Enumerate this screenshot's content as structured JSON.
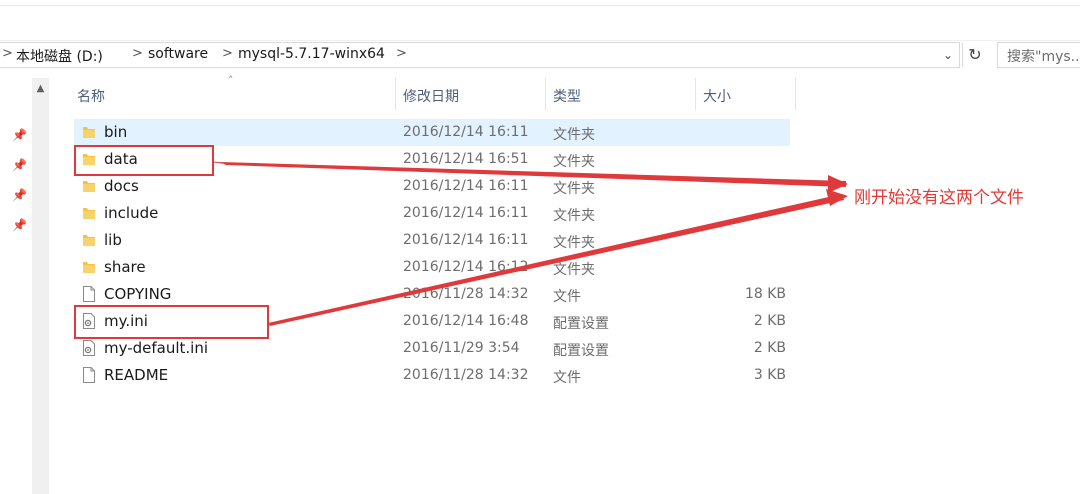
{
  "breadcrumb": {
    "items": [
      "本地磁盘 (D:)",
      "software",
      "mysql-5.7.17-winx64"
    ],
    "separator": ">"
  },
  "search": {
    "placeholder": "搜索\"mys..."
  },
  "columns": {
    "name": "名称",
    "date": "修改日期",
    "type": "类型",
    "size": "大小"
  },
  "files": [
    {
      "name": "bin",
      "date": "2016/12/14 16:11",
      "type": "文件夹",
      "size": "",
      "icon": "folder-icon",
      "selected": true
    },
    {
      "name": "data",
      "date": "2016/12/14 16:51",
      "type": "文件夹",
      "size": "",
      "icon": "folder-icon"
    },
    {
      "name": "docs",
      "date": "2016/12/14 16:11",
      "type": "文件夹",
      "size": "",
      "icon": "folder-icon"
    },
    {
      "name": "include",
      "date": "2016/12/14 16:11",
      "type": "文件夹",
      "size": "",
      "icon": "folder-icon"
    },
    {
      "name": "lib",
      "date": "2016/12/14 16:11",
      "type": "文件夹",
      "size": "",
      "icon": "folder-icon"
    },
    {
      "name": "share",
      "date": "2016/12/14 16:12",
      "type": "文件夹",
      "size": "",
      "icon": "folder-icon"
    },
    {
      "name": "COPYING",
      "date": "2016/11/28 14:32",
      "type": "文件",
      "size": "18 KB",
      "icon": "file-icon"
    },
    {
      "name": "my.ini",
      "date": "2016/12/14 16:48",
      "type": "配置设置",
      "size": "2 KB",
      "icon": "settings-file-icon"
    },
    {
      "name": "my-default.ini",
      "date": "2016/11/29 3:54",
      "type": "配置设置",
      "size": "2 KB",
      "icon": "settings-file-icon"
    },
    {
      "name": "README",
      "date": "2016/11/28 14:32",
      "type": "文件",
      "size": "3 KB",
      "icon": "file-icon"
    }
  ],
  "annotation": {
    "text": "刚开始没有这两个文件",
    "color": "#e53935"
  },
  "colors": {
    "selection": "#cce8ff",
    "annotation": "#e0393b",
    "header_text": "#4c607a",
    "folder": "#f5c342"
  }
}
